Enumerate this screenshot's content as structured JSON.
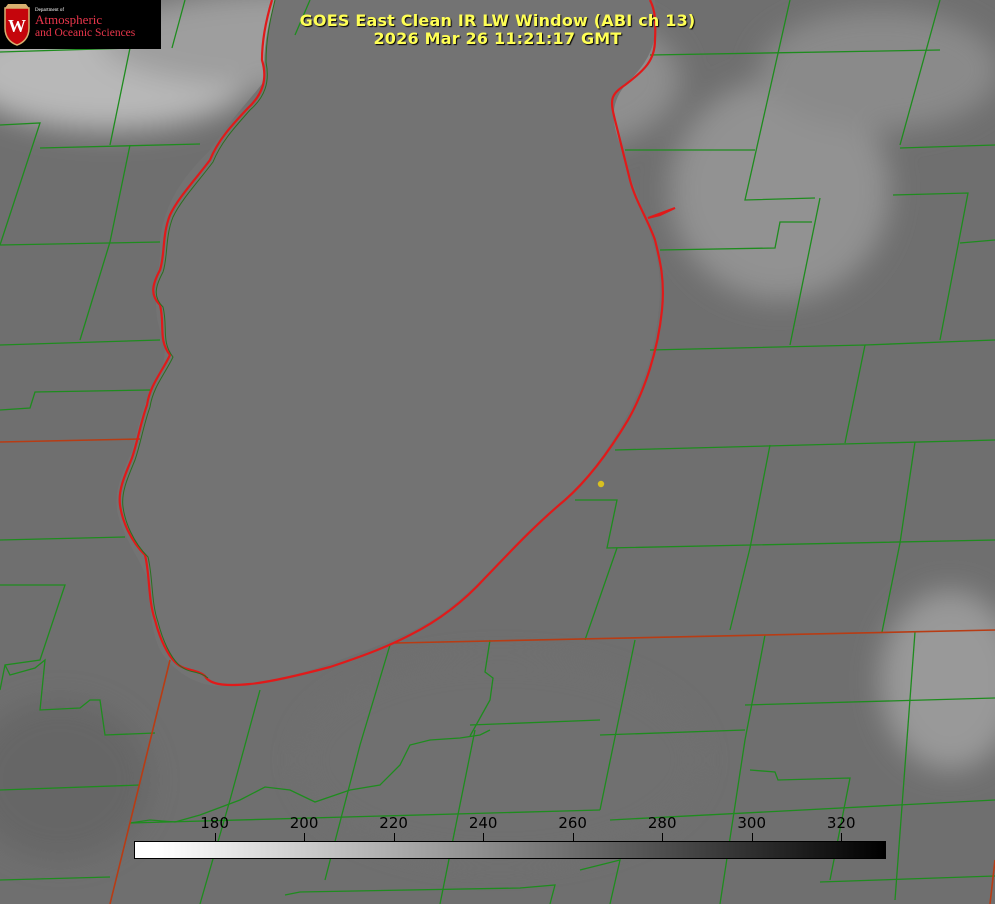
{
  "header": {
    "title_line1": "GOES East Clean IR LW Window (ABI ch 13)",
    "title_line2": "2026 Mar 26 11:21:17 GMT"
  },
  "logo": {
    "department": "Department of",
    "line1": "Atmospheric",
    "line2": "and Oceanic Sciences",
    "seal_letter": "W"
  },
  "colorbar": {
    "scale_min": 162,
    "scale_max": 330,
    "gradient": "white-to-black",
    "ticks": [
      180,
      200,
      220,
      240,
      260,
      280,
      300,
      320
    ],
    "tick_labels": [
      "180",
      "200",
      "220",
      "240",
      "260",
      "280",
      "300",
      "320"
    ]
  },
  "map": {
    "colors": {
      "county_borders": "#1e8c1e",
      "state_borders": "#b83c14",
      "lake_outline": "#e01a1a",
      "marker": "#d8c020",
      "cloud_top_bright": "#c8c8c8"
    }
  }
}
